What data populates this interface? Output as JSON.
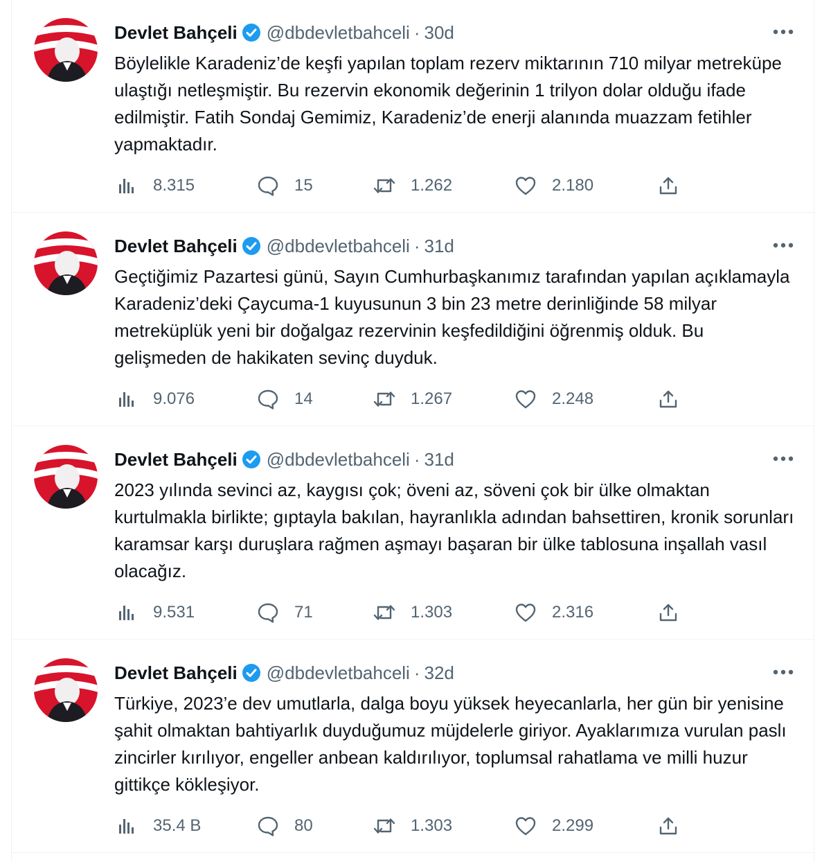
{
  "colors": {
    "text": "#0f1419",
    "secondary": "#536471",
    "verified": "#1d9bf0",
    "border": "#eff3f4",
    "avatar_red": "#d7142b"
  },
  "icons": {
    "verified": "verified-badge-icon",
    "more": "more-dots-icon",
    "views": "views-bars-icon",
    "reply": "reply-bubble-icon",
    "retweet": "retweet-icon",
    "like": "heart-icon",
    "share": "share-upload-icon"
  },
  "tweets": [
    {
      "name": "Devlet Bahçeli",
      "handle": "@dbdevletbahceli",
      "separator": "·",
      "time": "30d",
      "text": "Böylelikle Karadeniz’de keşfi yapılan toplam rezerv miktarının 710 milyar metreküpe ulaştığı netleşmiştir. Bu rezervin ekonomik değerinin 1 trilyon dolar olduğu ifade edilmiştir. Fatih Sondaj Gemimiz, Karadeniz’de enerji alanında muazzam fetihler yapmaktadır.",
      "views": "8.315",
      "replies": "15",
      "retweets": "1.262",
      "likes": "2.180"
    },
    {
      "name": "Devlet Bahçeli",
      "handle": "@dbdevletbahceli",
      "separator": "·",
      "time": "31d",
      "text": "Geçtiğimiz Pazartesi günü, Sayın Cumhurbaşkanımız tarafından yapılan açıklamayla Karadeniz’deki Çaycuma-1 kuyusunun 3 bin 23 metre derinliğinde 58 milyar metreküplük yeni bir doğalgaz rezervinin keşfedildiğini öğrenmiş olduk. Bu gelişmeden de hakikaten sevinç duyduk.",
      "views": "9.076",
      "replies": "14",
      "retweets": "1.267",
      "likes": "2.248"
    },
    {
      "name": "Devlet Bahçeli",
      "handle": "@dbdevletbahceli",
      "separator": "·",
      "time": "31d",
      "text": "2023 yılında sevinci az, kaygısı çok; öveni az, söveni çok bir ülke olmaktan kurtulmakla birlikte; gıptayla bakılan, hayranlıkla adından bahsettiren, kronik sorunları karamsar karşı duruşlara rağmen aşmayı başaran bir ülke tablosuna inşallah vasıl olacağız.",
      "views": "9.531",
      "replies": "71",
      "retweets": "1.303",
      "likes": "2.316"
    },
    {
      "name": "Devlet Bahçeli",
      "handle": "@dbdevletbahceli",
      "separator": "·",
      "time": "32d",
      "text": "Türkiye, 2023’e dev umutlarla, dalga boyu yüksek heyecanlarla, her gün bir yenisine şahit olmaktan bahtiyarlık duyduğumuz müjdelerle giriyor. Ayaklarımıza vurulan paslı zincirler kırılıyor, engeller anbean kaldırılıyor, toplumsal rahatlama ve milli huzur gittikçe kökleşiyor.",
      "views": "35.4 B",
      "replies": "80",
      "retweets": "1.303",
      "likes": "2.299"
    }
  ]
}
